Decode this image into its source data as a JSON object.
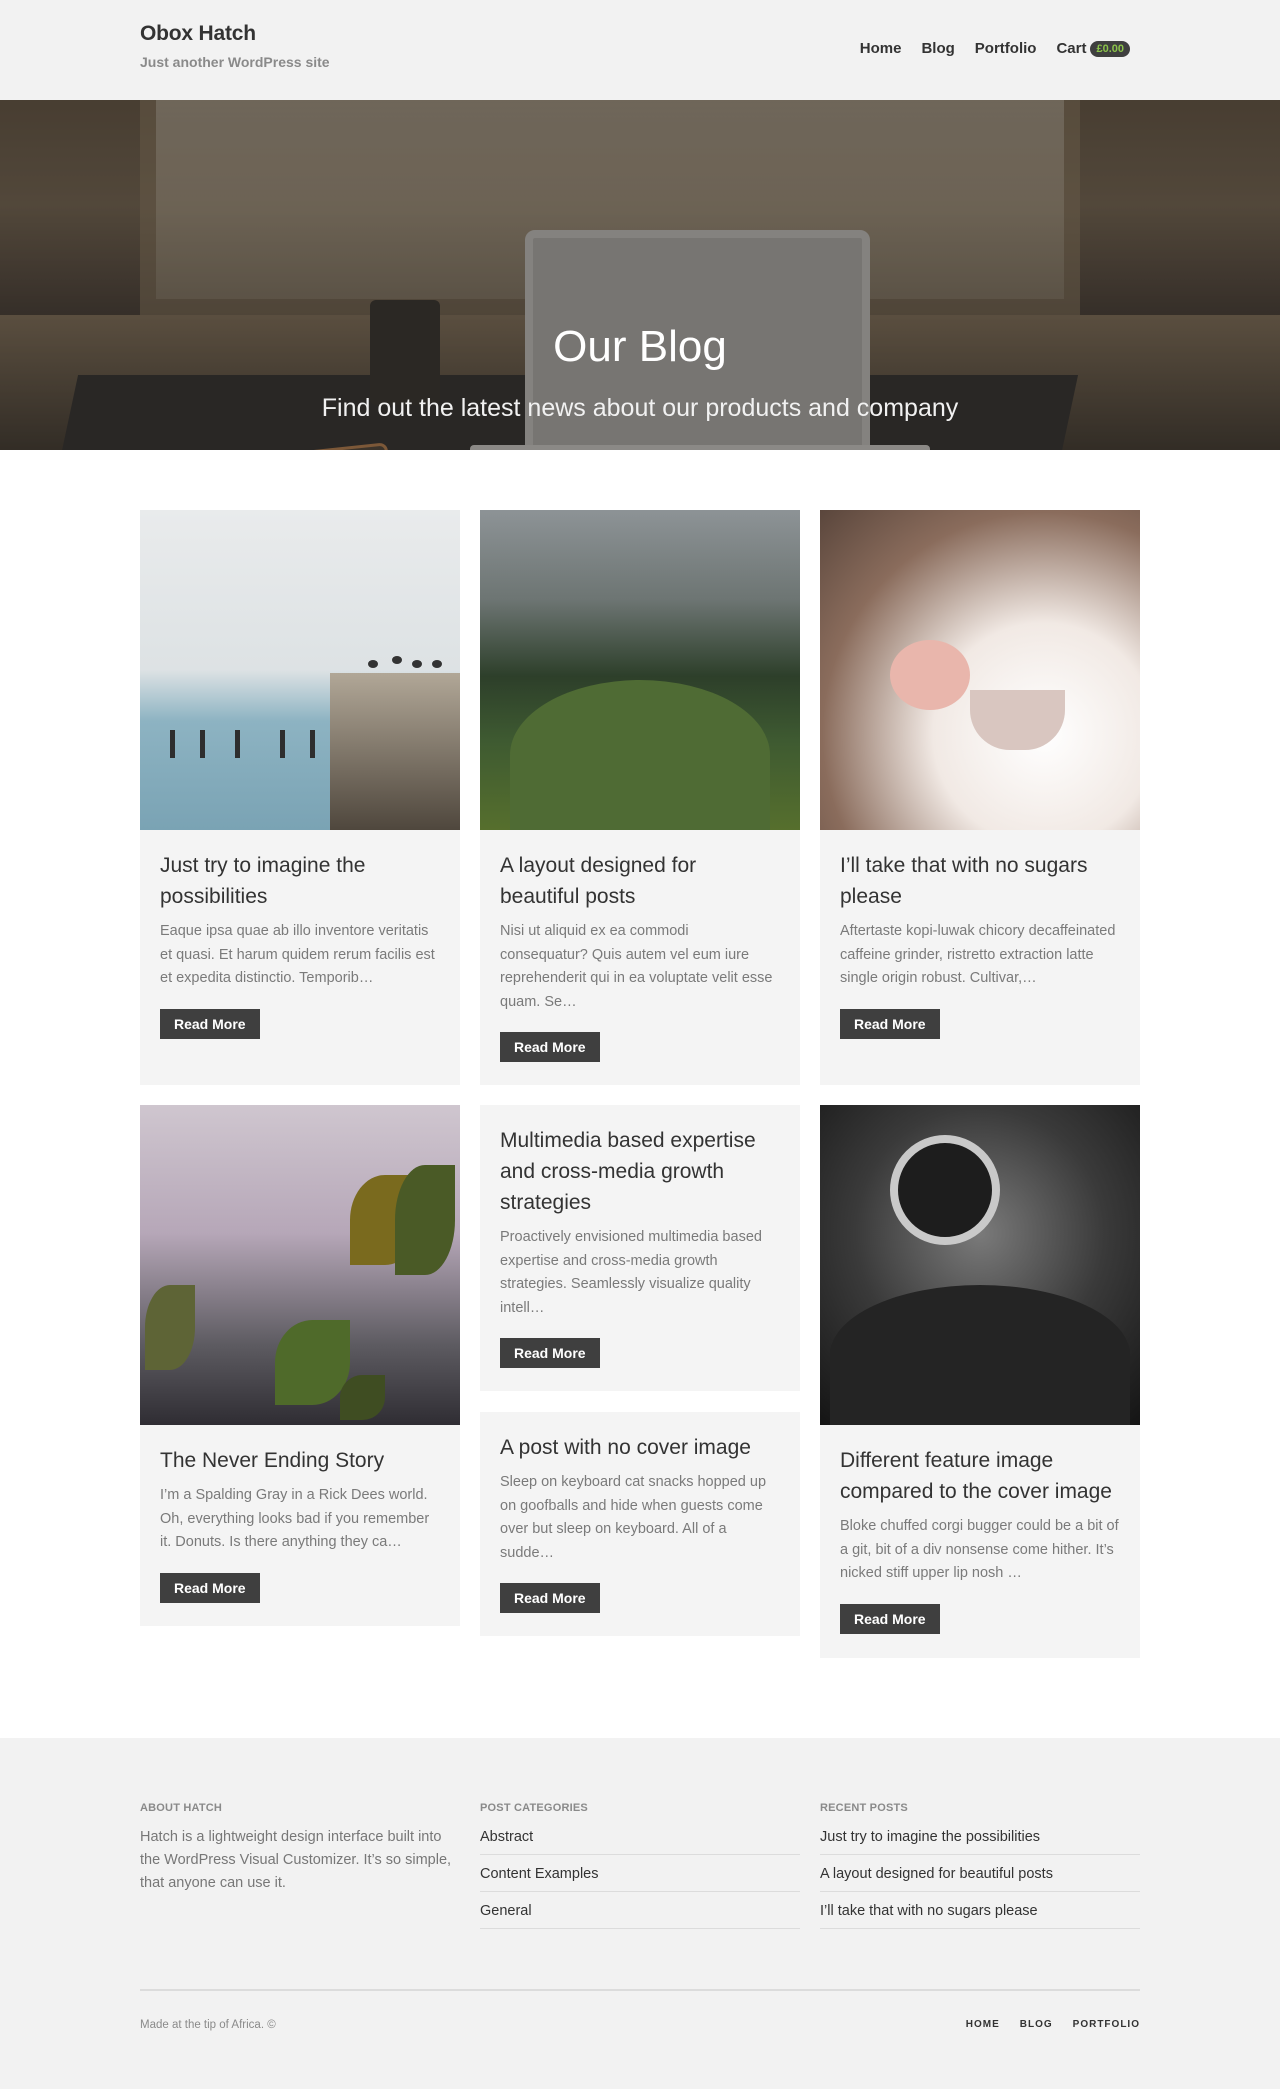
{
  "header": {
    "site_title": "Obox Hatch",
    "tagline": "Just another WordPress site",
    "nav": [
      {
        "label": "Home"
      },
      {
        "label": "Blog"
      },
      {
        "label": "Portfolio"
      },
      {
        "label": "Cart"
      }
    ],
    "cart_total": "£0.00"
  },
  "hero": {
    "title": "Our Blog",
    "subtitle": "Find out the latest news about our products and company"
  },
  "posts": [
    {
      "title": "Just try to imagine the possibilities",
      "excerpt": "Eaque ipsa quae ab illo inventore veritatis et quasi. Et harum quidem rerum facilis est et expedita distinctio. Temporib…",
      "button": "Read More"
    },
    {
      "title": "A layout designed for beautiful posts",
      "excerpt": "Nisi ut aliquid ex ea commodi consequatur? Quis autem vel eum iure reprehenderit qui in ea voluptate velit esse quam. Se…",
      "button": "Read More"
    },
    {
      "title": "I’ll take that with no sugars please",
      "excerpt": "Aftertaste kopi-luwak chicory decaffeinated caffeine grinder, ristretto extraction latte single origin robust. Cultivar,…",
      "button": "Read More"
    },
    {
      "title": "The Never Ending Story",
      "excerpt": "I’m a Spalding Gray in a Rick Dees world. Oh, everything looks bad if you remember it. Donuts. Is there anything they ca…",
      "button": "Read More"
    },
    {
      "title": "Multimedia based expertise and cross-media growth strategies",
      "excerpt": "Proactively envisioned multimedia based expertise and cross-media growth strategies. Seamlessly visualize quality intell…",
      "button": "Read More"
    },
    {
      "title": "A post with no cover image",
      "excerpt": "Sleep on keyboard cat snacks hopped up on goofballs and hide when guests come over but sleep on keyboard. All of a sudde…",
      "button": "Read More"
    },
    {
      "title": "Different feature image compared to the cover image",
      "excerpt": "Bloke chuffed corgi bugger could be a bit of a git, bit of a div nonsense come hither. It’s nicked stiff upper lip nosh …",
      "button": "Read More"
    }
  ],
  "footer": {
    "about_heading": "About Hatch",
    "about_text": "Hatch is a lightweight design interface built into the WordPress Visual Customizer. It’s so simple, that anyone can use it.",
    "categories_heading": "Post Categories",
    "categories": [
      "Abstract",
      "Content Examples",
      "General"
    ],
    "recent_heading": "Recent Posts",
    "recent": [
      "Just try to imagine the possibilities",
      "A layout designed for beautiful posts",
      "I’ll take that with no sugars please"
    ],
    "copyright": "Made at the tip of Africa. ©",
    "nav": [
      "HOME",
      "BLOG",
      "PORTFOLIO"
    ]
  },
  "colors": {
    "accent": "#3f3f3f",
    "cart_badge_text": "#8bc34a",
    "page_bg": "#f2f2f2",
    "card_bg": "#f4f4f4"
  },
  "icons": {
    "cart": "none-visible"
  }
}
